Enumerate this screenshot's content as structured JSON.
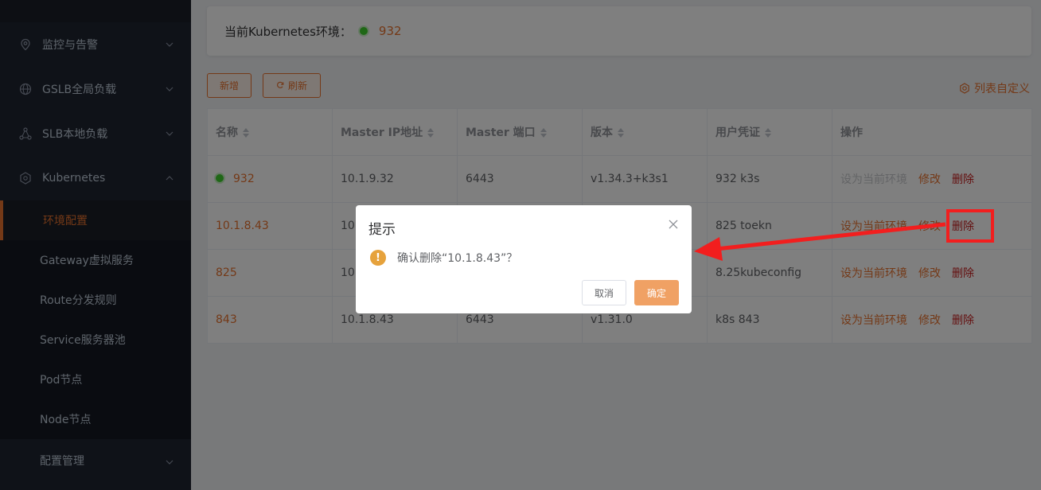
{
  "sidebar": {
    "items": [
      {
        "label": "监控与告警",
        "icon": "location-pin-icon"
      },
      {
        "label": "GSLB全局负载",
        "icon": "globe-icon"
      },
      {
        "label": "SLB本地负载",
        "icon": "network-nodes-icon"
      },
      {
        "label": "Kubernetes",
        "icon": "kubernetes-icon"
      }
    ],
    "sub_items": [
      "环境配置",
      "Gateway虚拟服务",
      "Route分发规则",
      "Service服务器池",
      "Pod节点",
      "Node节点"
    ],
    "bottom_item": "配置管理"
  },
  "env": {
    "label": "当前Kubernetes环境：",
    "value": "932"
  },
  "toolbar": {
    "add": "新增",
    "refresh": "刷新",
    "column_settings": "列表自定义"
  },
  "table": {
    "headers": [
      "名称",
      "Master IP地址",
      "Master 端口",
      "版本",
      "用户凭证",
      "操作"
    ],
    "rows": [
      {
        "name": "932",
        "ip": "10.1.9.32",
        "port": "6443",
        "version": "v1.34.3+k3s1",
        "cred": "932 k3s",
        "active": true
      },
      {
        "name": "10.1.8.43",
        "ip": "10.",
        "port": "",
        "version": "",
        "cred": "825 toekn",
        "active": false
      },
      {
        "name": "825",
        "ip": "10.",
        "port": "",
        "version": "",
        "cred": "8.25kubeconfig",
        "active": false
      },
      {
        "name": "843",
        "ip": "10.1.8.43",
        "port": "6443",
        "version": "v1.31.0",
        "cred": "k8s 843",
        "active": false
      }
    ],
    "ops": {
      "set_current": "设为当前环境",
      "edit": "修改",
      "delete": "删除"
    }
  },
  "dialog": {
    "title": "提示",
    "message": "确认删除“10.1.8.43”？",
    "cancel": "取消",
    "ok": "确定"
  },
  "colors": {
    "accent": "#e8722e",
    "danger": "#c81e1e",
    "sidebar_bg": "#1f2430",
    "annotation": "#f21e1e"
  }
}
